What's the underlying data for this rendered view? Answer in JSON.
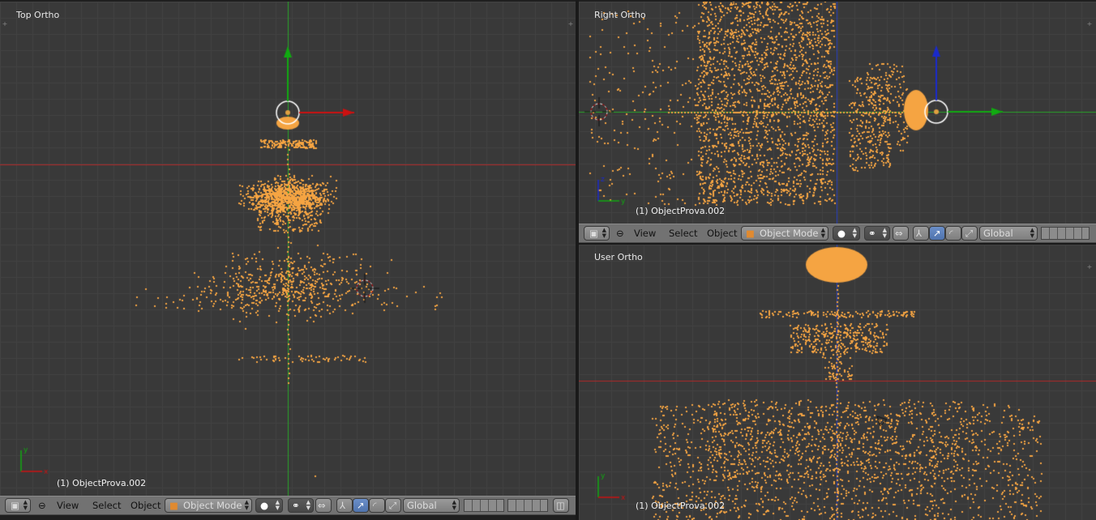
{
  "viewports": {
    "top": {
      "label": "Top Ortho",
      "object_label": "(1) ObjectProva.002",
      "axis_a": "y",
      "axis_b": "x"
    },
    "right": {
      "label": "Right Ortho",
      "object_label": "(1) ObjectProva.002",
      "axis_a": "z",
      "axis_b": "y"
    },
    "user": {
      "label": "User Ortho",
      "object_label": "(1) ObjectProva.002",
      "axis_a": "y",
      "axis_b": "x"
    }
  },
  "header": {
    "view": "View",
    "select": "Select",
    "object": "Object",
    "mode": "Object Mode",
    "orientation": "Global"
  },
  "colors": {
    "viewport_bg": "#393939",
    "grid": "#434343",
    "points": "#f5a442",
    "axis_x": "#b02a2a",
    "axis_y": "#2aa52a",
    "axis_z": "#2a40c0",
    "header_bg": "#727272"
  },
  "icons": [
    "cube-icon",
    "plus-icon",
    "solid-sphere-icon",
    "overlap-icon",
    "manipulator-icon",
    "translate-icon",
    "rotate-icon",
    "scale-icon",
    "layers-icon",
    "camera-icon"
  ]
}
